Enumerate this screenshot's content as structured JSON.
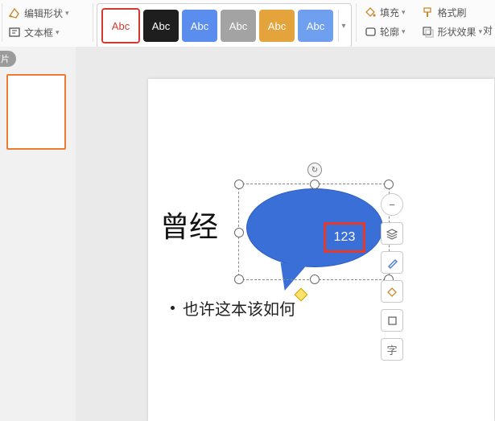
{
  "ribbon": {
    "edit_shape": "编辑形状",
    "text_box": "文本框",
    "styles": [
      "Abc",
      "Abc",
      "Abc",
      "Abc",
      "Abc",
      "Abc"
    ],
    "fill": "填充",
    "format_painter": "格式刷",
    "outline": "轮廓",
    "shape_effects": "形状效果",
    "right_cut": "对"
  },
  "panel": {
    "tab": "灯片"
  },
  "slide": {
    "title": "曾经",
    "shape_text": "123",
    "bullet": "也许这本该如何"
  },
  "float": {
    "text_btn": "字"
  }
}
